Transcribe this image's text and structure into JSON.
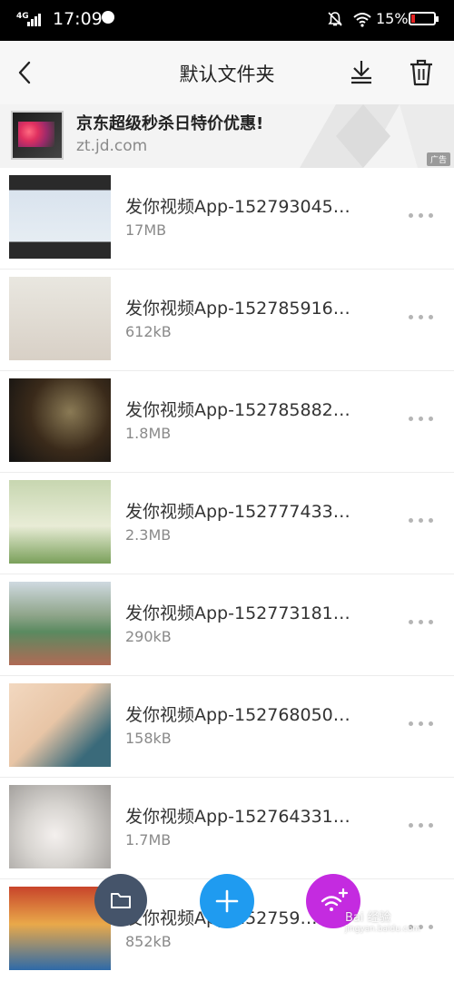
{
  "status_bar": {
    "network": "4G",
    "time": "17:09",
    "battery_percent": "15%",
    "battery_level": 0.15
  },
  "nav": {
    "title": "默认文件夹"
  },
  "ad": {
    "title": "京东超级秒杀日特价优惠!",
    "url": "zt.jd.com",
    "tag": "广告"
  },
  "files": [
    {
      "name": "发你视频App-152793045…",
      "size": "17MB"
    },
    {
      "name": "发你视频App-152785916…",
      "size": "612kB"
    },
    {
      "name": "发你视频App-152785882…",
      "size": "1.8MB"
    },
    {
      "name": "发你视频App-152777433…",
      "size": "2.3MB"
    },
    {
      "name": "发你视频App-152773181…",
      "size": "290kB"
    },
    {
      "name": "发你视频App-152768050…",
      "size": "158kB"
    },
    {
      "name": "发你视频App-152764331…",
      "size": "1.7MB"
    },
    {
      "name": "发你视频App-152759…",
      "size": "852kB"
    }
  ],
  "watermark": {
    "text": "Bai 经验",
    "sub": "jingyan.baidu.com"
  },
  "colors": {
    "status_bg": "#000000",
    "nav_bg": "#f7f7f7",
    "fab_folder": "#45546a",
    "fab_add": "#1f9bf0",
    "fab_wifi": "#c42be0"
  }
}
